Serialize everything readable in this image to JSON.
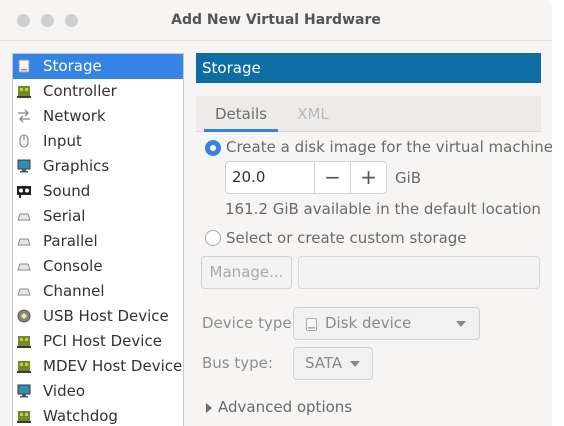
{
  "window": {
    "title": "Add New Virtual Hardware"
  },
  "sidebar": {
    "items": [
      {
        "label": "Storage",
        "icon": "storage-icon",
        "selected": true
      },
      {
        "label": "Controller",
        "icon": "controller-icon"
      },
      {
        "label": "Network",
        "icon": "network-icon"
      },
      {
        "label": "Input",
        "icon": "input-icon"
      },
      {
        "label": "Graphics",
        "icon": "graphics-icon"
      },
      {
        "label": "Sound",
        "icon": "sound-icon"
      },
      {
        "label": "Serial",
        "icon": "serial-icon"
      },
      {
        "label": "Parallel",
        "icon": "parallel-icon"
      },
      {
        "label": "Console",
        "icon": "console-icon"
      },
      {
        "label": "Channel",
        "icon": "channel-icon"
      },
      {
        "label": "USB Host Device",
        "icon": "usb-icon"
      },
      {
        "label": "PCI Host Device",
        "icon": "pci-icon"
      },
      {
        "label": "MDEV Host Device",
        "icon": "mdev-icon"
      },
      {
        "label": "Video",
        "icon": "video-icon"
      },
      {
        "label": "Watchdog",
        "icon": "watchdog-icon"
      }
    ]
  },
  "main": {
    "header": "Storage",
    "tabs": [
      {
        "label": "Details"
      },
      {
        "label": "XML"
      }
    ],
    "create_disk_label": "Create a disk image for the virtual machine",
    "size_value": "20.0",
    "size_unit": "GiB",
    "available_text": "161.2 GiB available in the default location",
    "custom_storage_label": "Select or create custom storage",
    "manage_button": "Manage...",
    "device_type_label": "Device type:",
    "device_type_value": "Disk device",
    "bus_type_label": "Bus type:",
    "bus_type_value": "SATA",
    "advanced_label": "Advanced options"
  },
  "colors": {
    "selection": "#3584e4",
    "header_bar": "#0e6ea4"
  }
}
